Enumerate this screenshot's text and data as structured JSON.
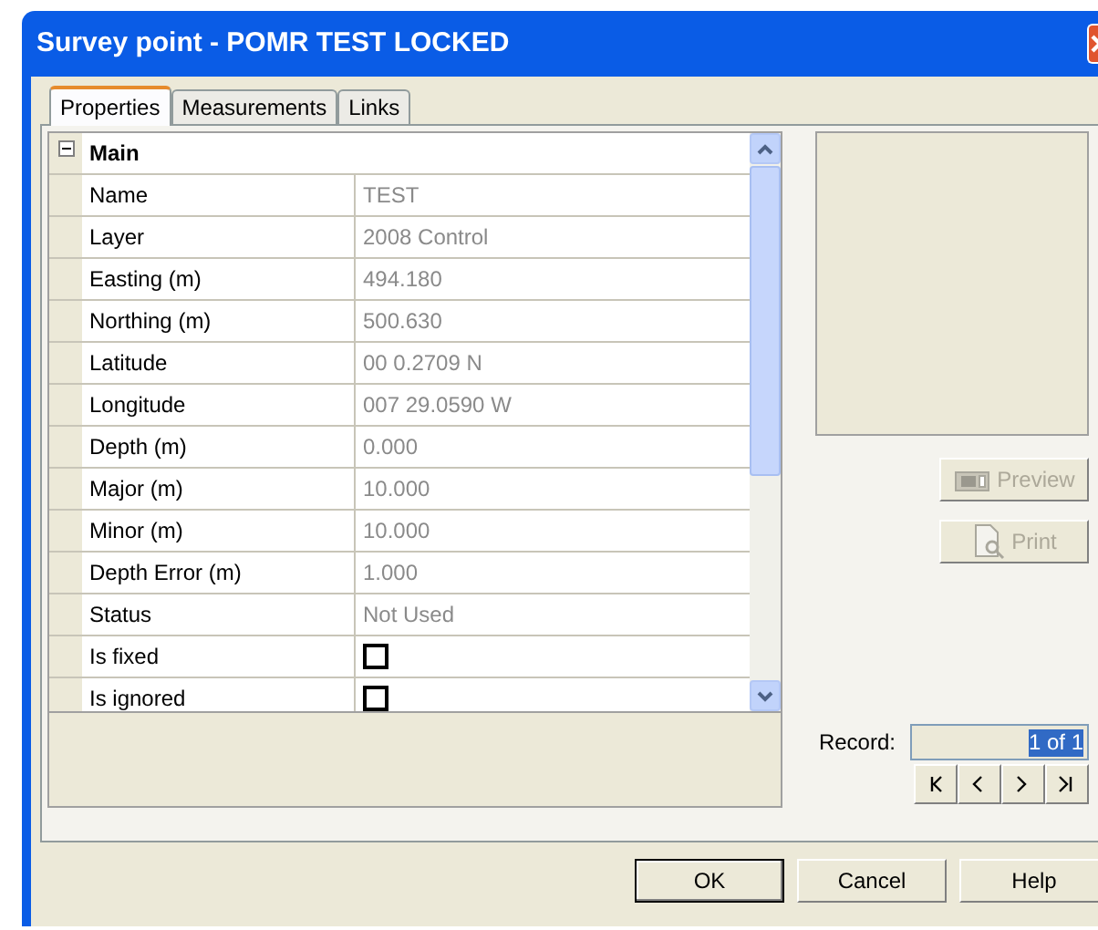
{
  "window": {
    "title": "Survey point - POMR TEST  LOCKED"
  },
  "tabs": [
    {
      "label": "Properties",
      "selected": true
    },
    {
      "label": "Measurements",
      "selected": false
    },
    {
      "label": "Links",
      "selected": false
    }
  ],
  "property_grid": {
    "category": {
      "label": "Main",
      "expanded": true
    },
    "rows": [
      {
        "kind": "text",
        "label": "Name",
        "value": "TEST"
      },
      {
        "kind": "text",
        "label": "Layer",
        "value": "2008 Control"
      },
      {
        "kind": "text",
        "label": "Easting (m)",
        "value": "494.180"
      },
      {
        "kind": "text",
        "label": "Northing (m)",
        "value": "500.630"
      },
      {
        "kind": "text",
        "label": "Latitude",
        "value": "00 0.2709 N"
      },
      {
        "kind": "text",
        "label": "Longitude",
        "value": "007 29.0590 W"
      },
      {
        "kind": "text",
        "label": "Depth (m)",
        "value": "0.000"
      },
      {
        "kind": "text",
        "label": "Major (m)",
        "value": "10.000"
      },
      {
        "kind": "text",
        "label": "Minor (m)",
        "value": "10.000"
      },
      {
        "kind": "text",
        "label": "Depth Error (m)",
        "value": "1.000"
      },
      {
        "kind": "text",
        "label": "Status",
        "value": "Not Used"
      },
      {
        "kind": "checkbox",
        "label": "Is fixed",
        "checked": false
      },
      {
        "kind": "checkbox",
        "label": "Is ignored",
        "checked": false
      }
    ]
  },
  "side_buttons": [
    {
      "kind": "preview",
      "label": "Preview",
      "disabled": true
    },
    {
      "kind": "print",
      "label": "Print",
      "disabled": true
    }
  ],
  "record": {
    "label": "Record:",
    "value": "1 of 1",
    "highlighted": true
  },
  "nav_buttons": [
    {
      "kind": "first"
    },
    {
      "kind": "prev"
    },
    {
      "kind": "next"
    },
    {
      "kind": "last"
    }
  ],
  "buttons": [
    {
      "label": "OK",
      "default": true
    },
    {
      "label": "Cancel",
      "default": false
    },
    {
      "label": "Help",
      "default": false
    }
  ]
}
